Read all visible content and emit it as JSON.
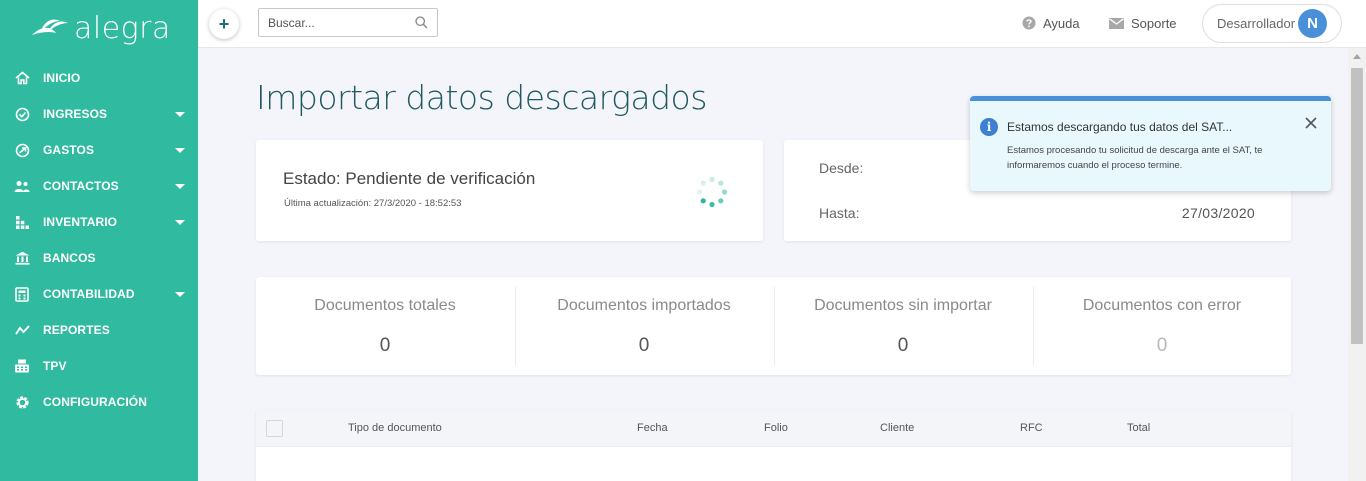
{
  "brand": {
    "name": "alegra"
  },
  "sidebar": {
    "items": [
      {
        "label": "INICIO",
        "icon": "home-icon",
        "has_submenu": false
      },
      {
        "label": "INGRESOS",
        "icon": "income-icon",
        "has_submenu": true
      },
      {
        "label": "GASTOS",
        "icon": "expenses-icon",
        "has_submenu": true
      },
      {
        "label": "CONTACTOS",
        "icon": "contacts-icon",
        "has_submenu": true
      },
      {
        "label": "INVENTARIO",
        "icon": "inventory-icon",
        "has_submenu": true
      },
      {
        "label": "BANCOS",
        "icon": "bank-icon",
        "has_submenu": false
      },
      {
        "label": "CONTABILIDAD",
        "icon": "accounting-icon",
        "has_submenu": true
      },
      {
        "label": "REPORTES",
        "icon": "reports-icon",
        "has_submenu": false
      },
      {
        "label": "TPV",
        "icon": "pos-icon",
        "has_submenu": false
      },
      {
        "label": "CONFIGURACIÓN",
        "icon": "gear-icon",
        "has_submenu": false
      }
    ]
  },
  "topbar": {
    "add_label": "+",
    "search_placeholder": "Buscar...",
    "help_label": "Ayuda",
    "support_label": "Soporte",
    "user_name": "Desarrollador",
    "user_initial": "N"
  },
  "page": {
    "title": "Importar datos descargados"
  },
  "status": {
    "title": "Estado: Pendiente de verificación",
    "updated": "Última actualización: 27/3/2020 - 18:52:53"
  },
  "dates": {
    "from_label": "Desde:",
    "to_label": "Hasta:",
    "to_value": "27/03/2020"
  },
  "stats": [
    {
      "label": "Documentos totales",
      "value": "0"
    },
    {
      "label": "Documentos importados",
      "value": "0"
    },
    {
      "label": "Documentos sin importar",
      "value": "0"
    },
    {
      "label": "Documentos con error",
      "value": "0"
    }
  ],
  "table": {
    "columns": [
      "Tipo de documento",
      "Fecha",
      "Folio",
      "Cliente",
      "RFC",
      "Total"
    ]
  },
  "toast": {
    "title": "Estamos descargando tus datos del SAT...",
    "message": "Estamos procesando tu solicitud de descarga ante el SAT, te informaremos cuando el proceso termine."
  },
  "colors": {
    "sidebar": "#30ba9f",
    "title": "#1f5a60",
    "accent_blue": "#4a90d9",
    "toast_bg": "#e8f8fd"
  }
}
